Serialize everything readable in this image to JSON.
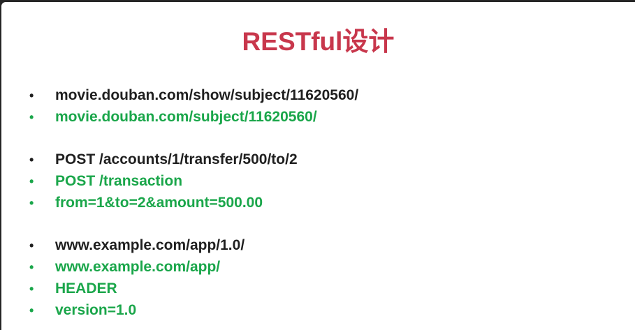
{
  "colors": {
    "title": "#c8374c",
    "normal": "#1f1f1f",
    "highlight": "#1aa64a"
  },
  "bullet_glyph": "•",
  "title": "RESTful设计",
  "groups": [
    {
      "items": [
        {
          "text": "movie.douban.com/show/subject/11620560/",
          "style": "normal"
        },
        {
          "text": "movie.douban.com/subject/11620560/",
          "style": "highlight"
        }
      ]
    },
    {
      "items": [
        {
          "text": "POST /accounts/1/transfer/500/to/2",
          "style": "normal"
        },
        {
          "text": "POST /transaction",
          "style": "highlight"
        },
        {
          "text": "from=1&to=2&amount=500.00",
          "style": "highlight"
        }
      ]
    },
    {
      "items": [
        {
          "text": "www.example.com/app/1.0/",
          "style": "normal"
        },
        {
          "text": "www.example.com/app/",
          "style": "highlight"
        },
        {
          "text": "HEADER",
          "style": "highlight"
        },
        {
          "text": "version=1.0",
          "style": "highlight"
        }
      ]
    }
  ]
}
